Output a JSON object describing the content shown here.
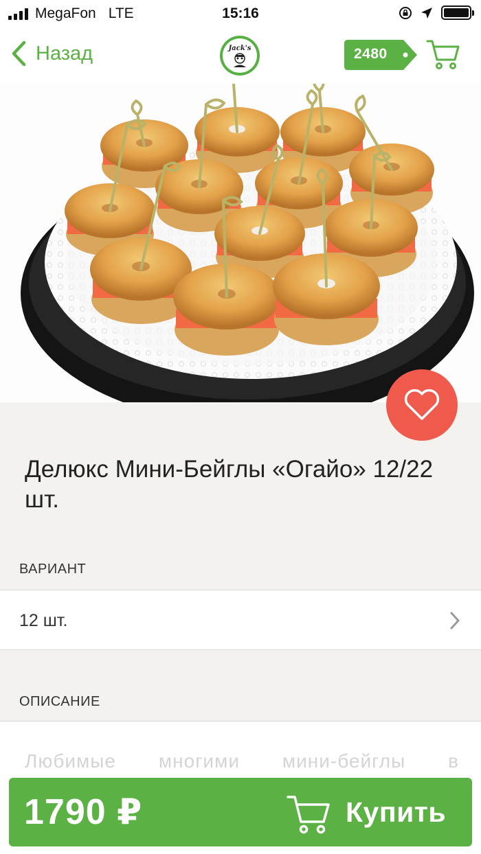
{
  "status_bar": {
    "carrier": "MegaFon",
    "network": "LTE",
    "time": "15:16"
  },
  "nav": {
    "back_label": "Назад",
    "balance": "2480"
  },
  "product": {
    "title": "Делюкс Мини-Бейглы «Огайо» 12/22 шт.",
    "variant_section_label": "ВАРИАНТ",
    "variant_value": "12 шт.",
    "description_section_label": "ОПИСАНИЕ",
    "description_preview": "Любимые многими мини-бейглы в"
  },
  "buy_bar": {
    "price": "1790 ₽",
    "buy_label": "Купить"
  },
  "colors": {
    "accent_green": "#5cb145",
    "favorite_red": "#ef5a4c",
    "background": "#f3f2ef"
  },
  "icons": [
    "signal-icon",
    "orientation-lock-icon",
    "location-arrow-icon",
    "battery-icon",
    "back-chevron-icon",
    "logo-icon",
    "cart-icon",
    "heart-icon",
    "chevron-right-icon"
  ]
}
